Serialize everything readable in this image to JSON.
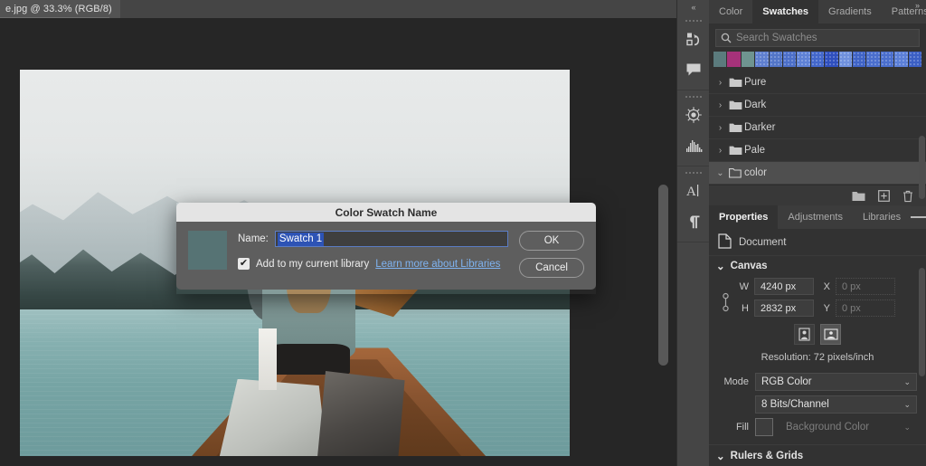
{
  "document_tab": {
    "label": "e.jpg @ 33.3% (RGB/8)"
  },
  "rail": {
    "collapse_label": "«",
    "groups": [
      {
        "items": [
          {
            "name": "history-icon",
            "tooltip": "History"
          },
          {
            "name": "comments-icon",
            "tooltip": "Comments"
          }
        ]
      },
      {
        "items": [
          {
            "name": "adjustments-wheel-icon",
            "tooltip": "Adjustments"
          },
          {
            "name": "histogram-icon",
            "tooltip": "Histogram"
          }
        ]
      },
      {
        "items": [
          {
            "name": "character-icon",
            "tooltip": "Character"
          },
          {
            "name": "paragraph-icon",
            "tooltip": "Paragraph"
          }
        ]
      }
    ]
  },
  "swatches_panel": {
    "collapse_label": "»",
    "tabs": [
      {
        "label": "Color",
        "active": false
      },
      {
        "label": "Swatches",
        "active": true
      },
      {
        "label": "Gradients",
        "active": false
      },
      {
        "label": "Patterns",
        "active": false
      }
    ],
    "menu_icon": "panel-menu-icon",
    "search": {
      "placeholder": "Search Swatches",
      "value": "",
      "icon": "search-icon"
    },
    "swatch_strip": [
      "#5b7b7d",
      "#a6327a",
      "#6f9490",
      "#5f7fd0",
      "#5275c8",
      "#4c6fc9",
      "#5e81d6",
      "#4367cb",
      "#2f4fbe",
      "#6f90dd",
      "#3f63c6",
      "#4a6ecd",
      "#4a6ecd",
      "#5b7fd8",
      "#3b5fc4"
    ],
    "folders": [
      {
        "label": "Pure",
        "expanded": false,
        "selected": false
      },
      {
        "label": "Dark",
        "expanded": false,
        "selected": false
      },
      {
        "label": "Darker",
        "expanded": false,
        "selected": false
      },
      {
        "label": "Pale",
        "expanded": false,
        "selected": false
      },
      {
        "label": "color",
        "expanded": true,
        "selected": true
      }
    ],
    "footer_icons": [
      {
        "name": "new-group-icon"
      },
      {
        "name": "new-swatch-icon"
      },
      {
        "name": "delete-swatch-icon"
      }
    ]
  },
  "properties_panel": {
    "tabs": [
      {
        "label": "Properties",
        "active": true
      },
      {
        "label": "Adjustments",
        "active": false
      },
      {
        "label": "Libraries",
        "active": false
      }
    ],
    "menu_icon": "panel-menu-icon",
    "doc_row": {
      "label": "Document",
      "icon": "document-icon"
    },
    "canvas": {
      "section_label": "Canvas",
      "width": {
        "label": "W",
        "value": "4240 px"
      },
      "height": {
        "label": "H",
        "value": "2832 px"
      },
      "x": {
        "label": "X",
        "value": "0 px"
      },
      "y": {
        "label": "Y",
        "value": "0 px"
      },
      "link_icon": "link-chain-icon",
      "orientation": [
        {
          "name": "portrait-orientation-icon",
          "active": false
        },
        {
          "name": "landscape-orientation-icon",
          "active": true
        }
      ],
      "resolution": "Resolution: 72 pixels/inch",
      "mode": {
        "label": "Mode",
        "value": "RGB Color"
      },
      "depth": {
        "value": "8 Bits/Channel"
      },
      "fill": {
        "label": "Fill",
        "value": "Background Color",
        "swatch": "#3d3d3d"
      }
    },
    "rulers_grids": {
      "label": "Rulers & Grids",
      "expanded": true
    }
  },
  "dialog": {
    "title": "Color Swatch Name",
    "swatch_color": "#567374",
    "name_label": "Name:",
    "name_value": "Swatch 1",
    "checkbox": {
      "checked": true,
      "label": "Add to my current library",
      "glyph": "✔"
    },
    "link_label": "Learn more about Libraries",
    "buttons": [
      {
        "label": "OK",
        "name": "ok-button"
      },
      {
        "label": "Cancel",
        "name": "cancel-button"
      }
    ]
  }
}
